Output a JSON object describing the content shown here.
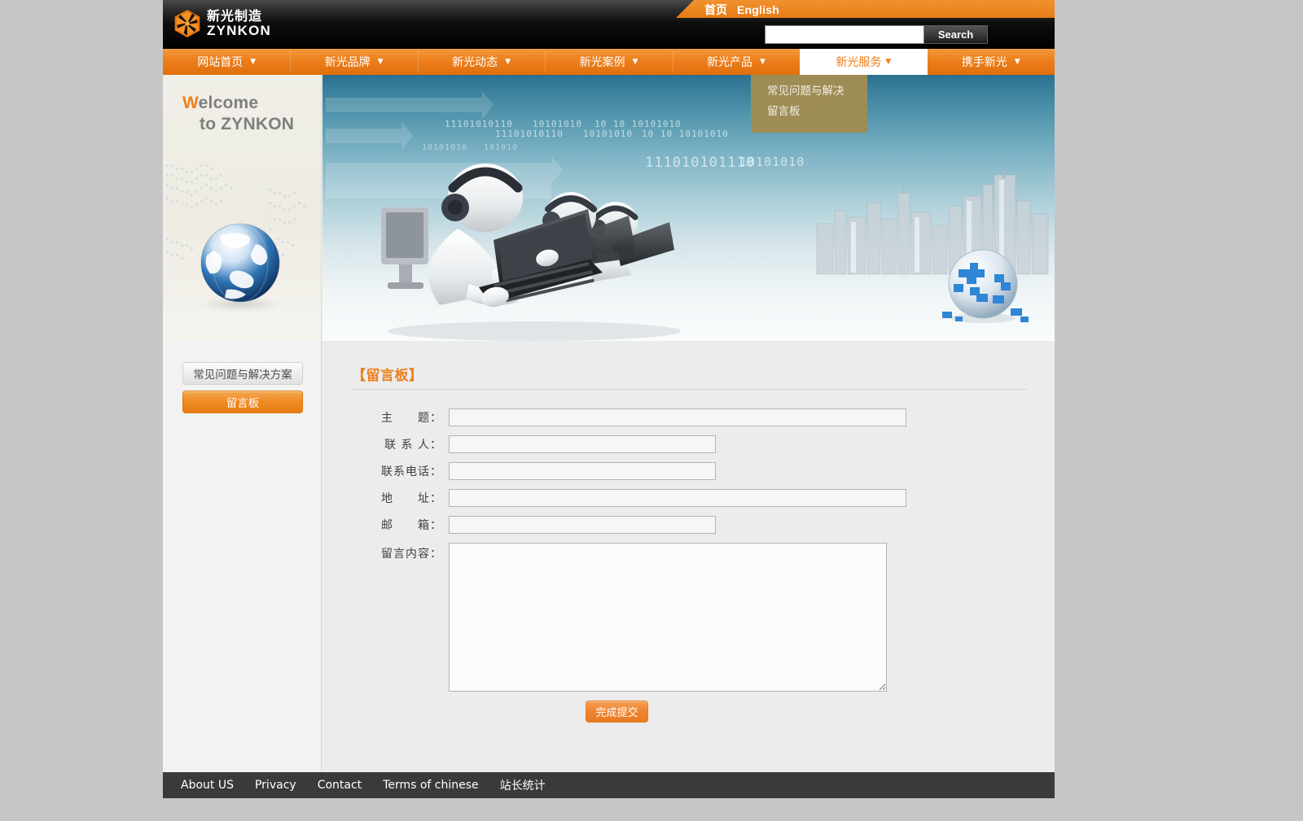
{
  "site": {
    "logo_cn": "新光制造",
    "logo_en": "ZYNKON"
  },
  "topbar": {
    "home_link": "首页",
    "english_link": "English",
    "search_value": "",
    "search_placeholder": "",
    "search_button": "Search"
  },
  "nav": {
    "items": [
      {
        "label": "网站首页",
        "caret": "▼",
        "active": false
      },
      {
        "label": "新光品牌",
        "caret": "▼",
        "active": false
      },
      {
        "label": "新光动态",
        "caret": "▼",
        "active": false
      },
      {
        "label": "新光案例",
        "caret": "▼",
        "active": false
      },
      {
        "label": "新光产品",
        "caret": "▼",
        "active": false
      },
      {
        "label": "新光服务",
        "caret": "▼",
        "active": true
      },
      {
        "label": "携手新光",
        "caret": "▼",
        "active": false
      }
    ]
  },
  "dropdown": {
    "items": [
      "常见问题与解决",
      "留言板"
    ]
  },
  "banner": {
    "welcome_w": "W",
    "welcome_rest": "elcome",
    "welcome_line2": "to ZYNKON",
    "binary_strings": [
      "11101010110",
      "10101010",
      "10 10 10101010",
      "11101010110",
      "10101010",
      "10 10 10101010",
      "10101010",
      "101010",
      "111010101110",
      "10101010"
    ]
  },
  "sidebar": {
    "items": [
      {
        "label": "常见问题与解决方案",
        "active": false
      },
      {
        "label": "留言板",
        "active": true
      }
    ]
  },
  "main": {
    "section_title": "【留言板】",
    "fields": [
      {
        "label": "主　　题：",
        "value": "",
        "size": "wide"
      },
      {
        "label": "联 系 人：",
        "value": "",
        "size": "narrow"
      },
      {
        "label": "联系电话：",
        "value": "",
        "size": "narrow"
      },
      {
        "label": "地　　址：",
        "value": "",
        "size": "wide"
      },
      {
        "label": "邮　　箱：",
        "value": "",
        "size": "narrow"
      }
    ],
    "message": {
      "label": "留言内容：",
      "value": ""
    },
    "submit_label": "完成提交"
  },
  "footer": {
    "links": [
      "About US",
      "Privacy",
      "Contact",
      "Terms of chinese",
      "站长统计"
    ]
  },
  "colors": {
    "accent_orange": "#ef7f1a",
    "nav_orange": "#ec7f1c",
    "dropdown_khaki": "#9e8c55",
    "footer_dark": "#3a3a3a",
    "content_bg": "#ececec"
  }
}
